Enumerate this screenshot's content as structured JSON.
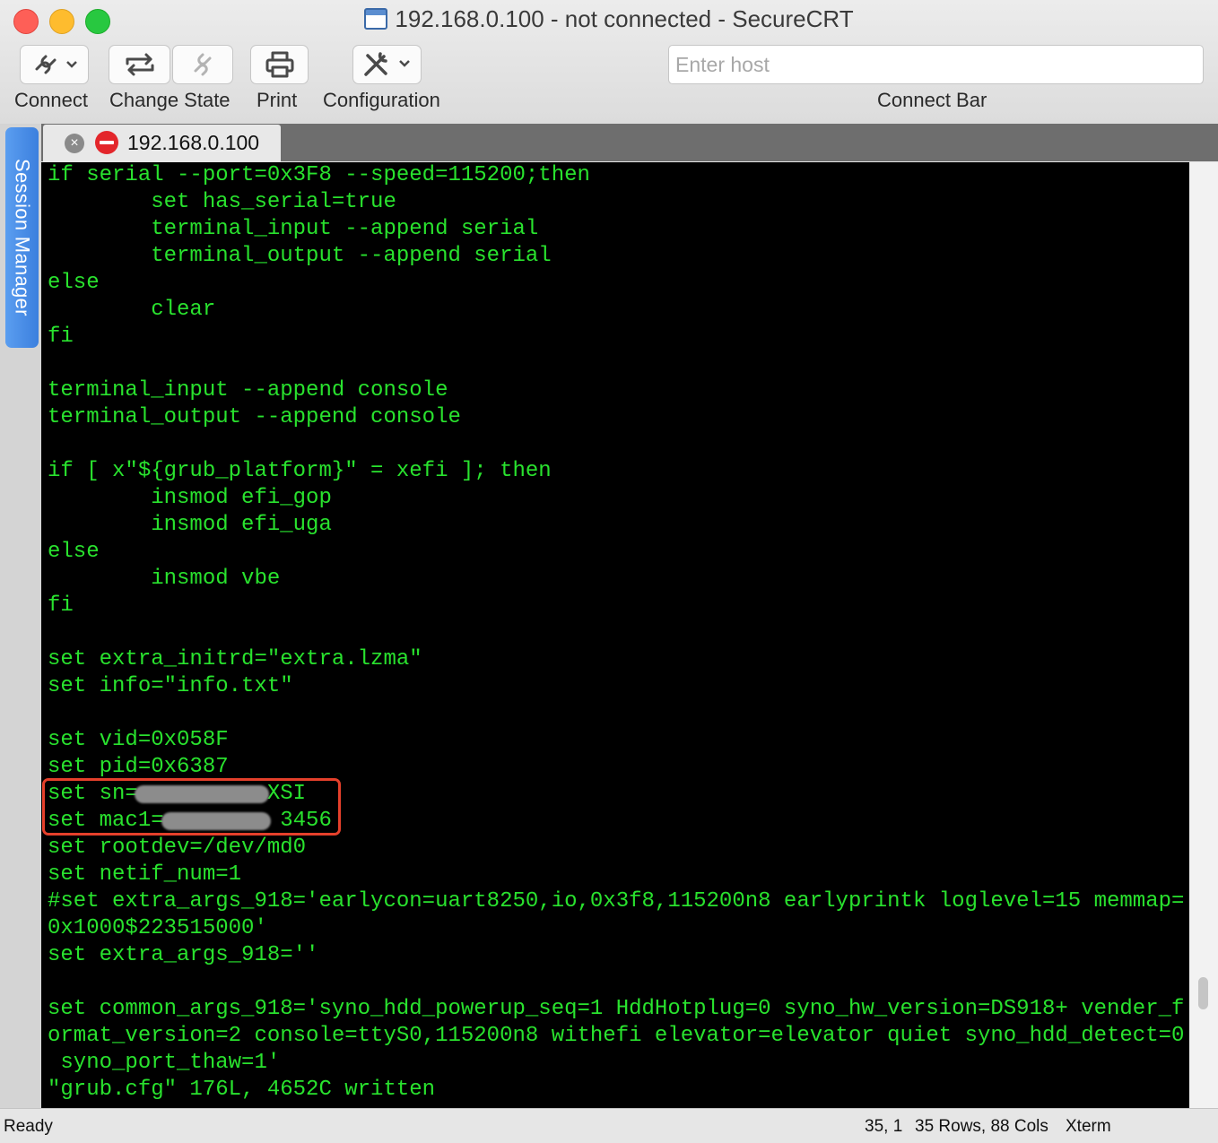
{
  "window": {
    "title": "192.168.0.100 - not connected - SecureCRT",
    "title_icon": "securecrt-app-icon"
  },
  "toolbar": {
    "connect_label": "Connect",
    "change_state_label": "Change State",
    "print_label": "Print",
    "configuration_label": "Configuration",
    "connect_bar_label": "Connect Bar",
    "host_placeholder": "Enter host",
    "icons": [
      "link-icon",
      "chevron-down-icon",
      "reconnect-icon",
      "unlink-icon",
      "printer-icon",
      "tools-icon",
      "chevron-down-icon"
    ]
  },
  "sidebar": {
    "session_manager_label": "Session Manager"
  },
  "tabs": [
    {
      "label": "192.168.0.100",
      "status": "disconnected",
      "status_color": "#e3262b"
    }
  ],
  "terminal": {
    "text_color": "#29e22e",
    "background": "#000000",
    "highlight_color": "#e5402b",
    "lines": [
      "if serial --port=0x3F8 --speed=115200;then",
      "        set has_serial=true",
      "        terminal_input --append serial",
      "        terminal_output --append serial",
      "else",
      "        clear",
      "fi",
      "",
      "terminal_input --append console",
      "terminal_output --append console",
      "",
      "if [ x\"${grub_platform}\" = xefi ]; then",
      "        insmod efi_gop",
      "        insmod efi_uga",
      "else",
      "        insmod vbe",
      "fi",
      "",
      "set extra_initrd=\"extra.lzma\"",
      "set info=\"info.txt\"",
      "",
      "set vid=0x058F",
      "set pid=0x6387",
      "set sn=          XSI",
      "set mac1=         3456",
      "set rootdev=/dev/md0",
      "set netif_num=1",
      "#set extra_args_918='earlycon=uart8250,io,0x3f8,115200n8 earlyprintk loglevel=15 memmap=",
      "0x1000$223515000'",
      "set extra_args_918=''",
      "",
      "set common_args_918='syno_hdd_powerup_seq=1 HddHotplug=0 syno_hw_version=DS918+ vender_f",
      "ormat_version=2 console=ttyS0,115200n8 withefi elevator=elevator quiet syno_hdd_detect=0",
      " syno_port_thaw=1'",
      "\"grub.cfg\" 176L, 4652C written"
    ]
  },
  "status_bar": {
    "state": "Ready",
    "cursor": "35, 1",
    "dimensions": "35 Rows, 88 Cols",
    "emulation": "Xterm"
  }
}
